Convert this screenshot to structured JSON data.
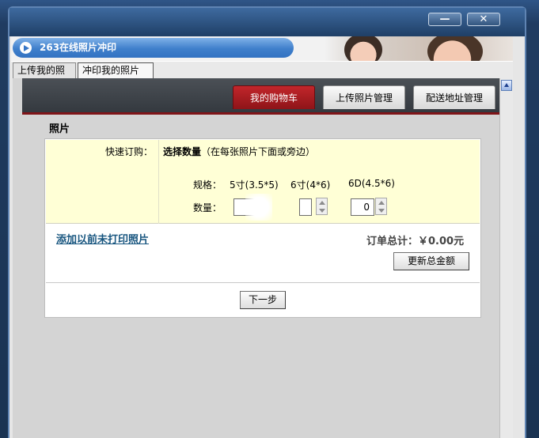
{
  "app": {
    "title": "263在线照片冲印"
  },
  "window": {
    "minimize_glyph": "—",
    "close_glyph": "✕"
  },
  "tabs": [
    {
      "label": "上传我的照片"
    },
    {
      "label": "冲印我的照片"
    }
  ],
  "nav": {
    "cart": "我的购物车",
    "upload_manage": "上传照片管理",
    "address_manage": "配送地址管理"
  },
  "section": {
    "title": "照片"
  },
  "quick_order": {
    "label": "快速订购：",
    "title_bold": "选择数量",
    "title_hint": "（在每张照片下面或旁边）",
    "spec_label": "规格：",
    "qty_label": "数量：",
    "sizes": [
      "5寸(3.5*5)",
      "6寸(4*6)",
      "6D(4.5*6)"
    ],
    "quantities": [
      "",
      "",
      "0"
    ]
  },
  "summary": {
    "add_link": "添加以前未打印照片",
    "total": "订单总计：￥0.00元",
    "update_button": "更新总金额"
  },
  "footer": {
    "next_button": "下一步"
  },
  "colors": {
    "accent_red": "#8e1418",
    "highlight_yellow": "#ffffd6",
    "link_blue": "#17557f"
  }
}
